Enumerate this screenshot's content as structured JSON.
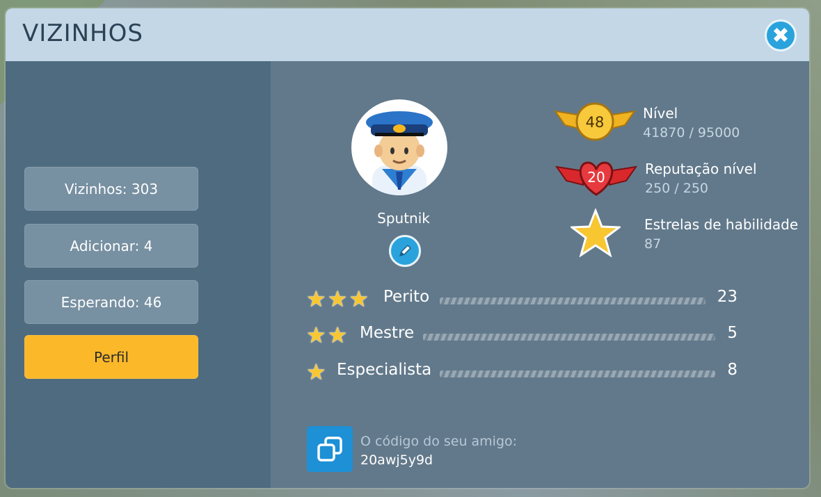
{
  "window": {
    "title": "VIZINHOS"
  },
  "sidebar": {
    "items": [
      {
        "label": "Vizinhos: 303"
      },
      {
        "label": "Adicionar: 4"
      },
      {
        "label": "Esperando: 46"
      },
      {
        "label": "Perfil",
        "active": true
      }
    ]
  },
  "profile": {
    "username": "Sputnik",
    "level": {
      "badge": "48",
      "label": "Nível",
      "value": "41870 / 95000"
    },
    "reputation": {
      "badge": "20",
      "label": "Reputação nível",
      "value": "250 / 250"
    },
    "skill_stars": {
      "label": "Estrelas de habilidade",
      "value": "87"
    }
  },
  "ranks": [
    {
      "name": "Perito",
      "stars": 3,
      "count": "23"
    },
    {
      "name": "Mestre",
      "stars": 2,
      "count": "5"
    },
    {
      "name": "Especialista",
      "stars": 1,
      "count": "8"
    }
  ],
  "friend_code": {
    "label": "O código do seu amigo:",
    "value": "20awj5y9d"
  },
  "colors": {
    "accent": "#2aa3dd",
    "active_tab": "#fbb829",
    "gold": "#f5b720",
    "red": "#d9282c"
  }
}
